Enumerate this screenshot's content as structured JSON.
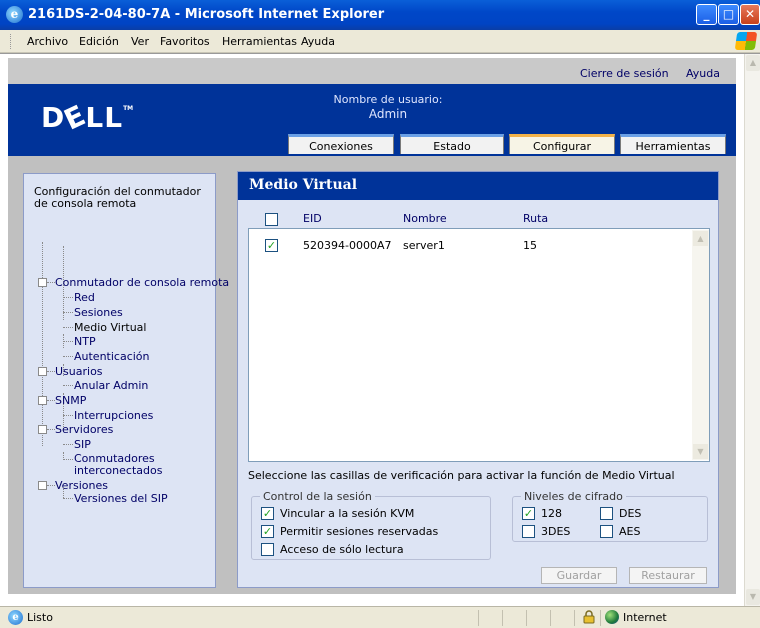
{
  "window": {
    "title": "2161DS-2-04-80-7A - Microsoft Internet Explorer",
    "icon_glyph": "e"
  },
  "menu": {
    "items": [
      "Archivo",
      "Edición",
      "Ver",
      "Favoritos",
      "Herramientas",
      "Ayuda"
    ]
  },
  "app": {
    "links": {
      "logout": "Cierre de sesión",
      "help": "Ayuda"
    },
    "logo": "DELL",
    "user_label": "Nombre de usuario:",
    "user_name": "Admin",
    "tabs": [
      {
        "label": "Conexiones",
        "active": false
      },
      {
        "label": "Estado",
        "active": false
      },
      {
        "label": "Configurar",
        "active": true
      },
      {
        "label": "Herramientas",
        "active": false
      }
    ]
  },
  "tree": {
    "title": "Configuración del conmutador de consola remota",
    "nodes": [
      {
        "label": "Conmutador de consola remota",
        "level": 0
      },
      {
        "label": "Red",
        "level": 1
      },
      {
        "label": "Sesiones",
        "level": 1
      },
      {
        "label": "Medio Virtual",
        "level": 1,
        "current": true
      },
      {
        "label": "NTP",
        "level": 1
      },
      {
        "label": "Autenticación",
        "level": 1
      },
      {
        "label": "Usuarios",
        "level": 0
      },
      {
        "label": "Anular Admin",
        "level": 1
      },
      {
        "label": "SNMP",
        "level": 0
      },
      {
        "label": "Interrupciones",
        "level": 1
      },
      {
        "label": "Servidores",
        "level": 0
      },
      {
        "label": "SIP",
        "level": 1
      },
      {
        "label": "Conmutadores interconectados",
        "level": 1
      },
      {
        "label": "Versiones",
        "level": 0
      },
      {
        "label": "Versiones del SIP",
        "level": 1
      }
    ]
  },
  "main": {
    "title": "Medio Virtual",
    "columns": [
      "EID",
      "Nombre",
      "Ruta"
    ],
    "select_all_checked": false,
    "rows": [
      {
        "checked": true,
        "eid": "520394-0000A7",
        "name": "server1",
        "path": "15"
      }
    ],
    "hint": "Seleccione las casillas de verificación para activar la función de Medio Virtual",
    "session_group": {
      "legend": "Control de la sesión",
      "options": [
        {
          "label": "Vincular a la sesión KVM",
          "checked": true
        },
        {
          "label": "Permitir sesiones reservadas",
          "checked": true
        },
        {
          "label": "Acceso de sólo lectura",
          "checked": false
        }
      ]
    },
    "encryption_group": {
      "legend": "Niveles de cifrado",
      "options": [
        {
          "label": "128",
          "checked": true
        },
        {
          "label": "DES",
          "checked": false
        },
        {
          "label": "3DES",
          "checked": false
        },
        {
          "label": "AES",
          "checked": false
        }
      ]
    },
    "buttons": {
      "save": "Guardar",
      "restore": "Restaurar"
    }
  },
  "status": {
    "text": "Listo",
    "zone": "Internet"
  },
  "icons": {
    "check_glyph": "✓",
    "up_arrow": "▲",
    "down_arrow": "▼"
  }
}
